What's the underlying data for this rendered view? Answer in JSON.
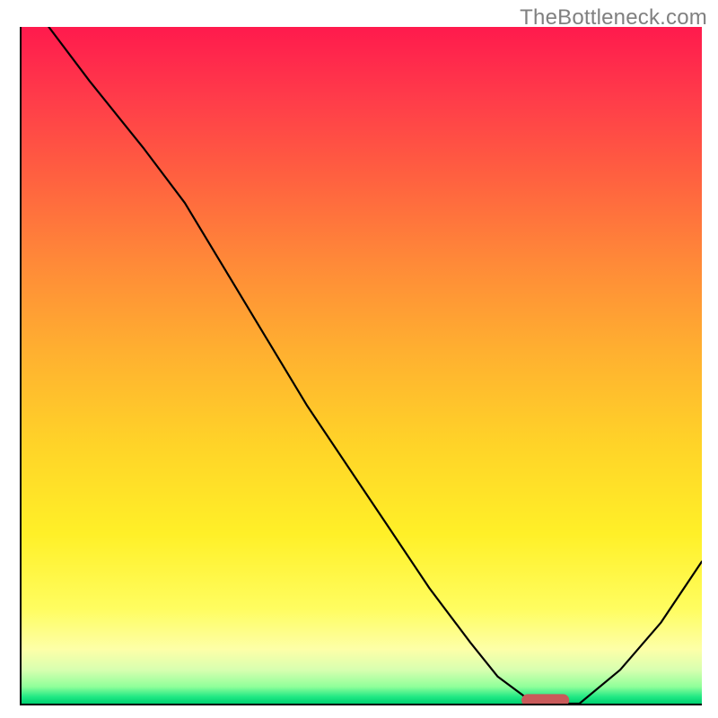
{
  "watermark": "TheBottleneck.com",
  "chart_data": {
    "type": "line",
    "title": "",
    "xlabel": "",
    "ylabel": "",
    "xlim": [
      0,
      100
    ],
    "ylim": [
      0,
      100
    ],
    "grid": false,
    "legend": false,
    "background_gradient": {
      "direction": "vertical",
      "stops": [
        {
          "pos": 0.0,
          "color": "#ff1a4d"
        },
        {
          "pos": 0.1,
          "color": "#ff3a4a"
        },
        {
          "pos": 0.22,
          "color": "#ff6040"
        },
        {
          "pos": 0.35,
          "color": "#ff8a38"
        },
        {
          "pos": 0.48,
          "color": "#ffb030"
        },
        {
          "pos": 0.62,
          "color": "#ffd428"
        },
        {
          "pos": 0.75,
          "color": "#fff028"
        },
        {
          "pos": 0.86,
          "color": "#fffd60"
        },
        {
          "pos": 0.92,
          "color": "#fdffa8"
        },
        {
          "pos": 0.95,
          "color": "#d8ffb0"
        },
        {
          "pos": 0.975,
          "color": "#90ff9a"
        },
        {
          "pos": 0.99,
          "color": "#20e884"
        },
        {
          "pos": 1.0,
          "color": "#00d070"
        }
      ]
    },
    "series": [
      {
        "name": "bottleneck-curve",
        "x": [
          4,
          10,
          18,
          24,
          30,
          36,
          42,
          48,
          54,
          60,
          66,
          70,
          74,
          78,
          82,
          88,
          94,
          100
        ],
        "y": [
          100,
          92,
          82,
          74,
          64,
          54,
          44,
          35,
          26,
          17,
          9,
          4,
          1,
          0,
          0,
          5,
          12,
          21
        ]
      }
    ],
    "marker": {
      "name": "optimal-marker",
      "shape": "rounded-rect",
      "color": "#c95a5a",
      "x_center": 77,
      "y_center": 0.5,
      "width": 7,
      "height": 1.8
    }
  }
}
